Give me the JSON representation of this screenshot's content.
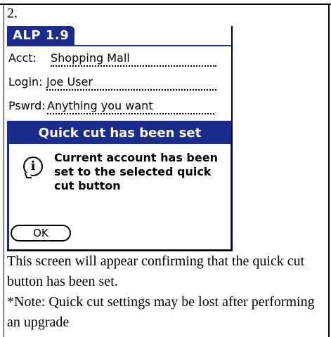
{
  "step_number": "2.",
  "app": {
    "title_tab": "ALP 1.9",
    "fields": {
      "acct_label": "Acct:",
      "acct_value": "Shopping Mall",
      "login_label": "Login:",
      "login_value": "Joe User",
      "pswd_label": "Pswrd:",
      "pswd_value": "Anything you want"
    }
  },
  "dialog": {
    "title": "Quick cut has been set",
    "icon": "info-icon",
    "message": "Current account has been set to the selected quick cut button",
    "ok_label": "OK"
  },
  "caption": {
    "line1": "This screen will appear confirming that the quick cut button has been set.",
    "line2": "*Note:  Quick cut settings may be lost after performing an upgrade"
  },
  "colors": {
    "palm_blue": "#1a2c8c",
    "background": "#ffffff",
    "text": "#000000"
  }
}
